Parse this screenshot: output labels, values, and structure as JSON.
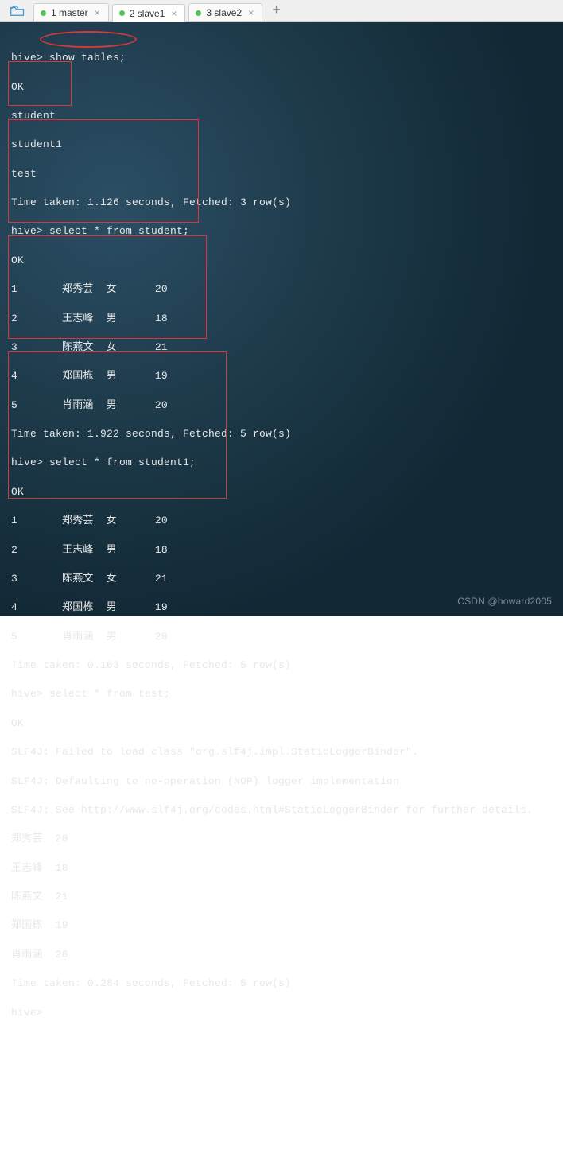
{
  "tabs": {
    "t1": "1 master",
    "t2": "2 slave1",
    "t3": "3 slave2",
    "active": "t2"
  },
  "terminal": {
    "prompt": "hive>",
    "cmd1": "show tables;",
    "ok": "OK",
    "tables": {
      "r0": "student",
      "r1": "student1",
      "r2": "test"
    },
    "time1": "Time taken: 1.126 seconds, Fetched: 3 row(s)",
    "cmd2": "select * from student;",
    "student": {
      "r0": "1       郑秀芸  女      20",
      "r1": "2       王志峰  男      18",
      "r2": "3       陈燕文  女      21",
      "r3": "4       郑国栋  男      19",
      "r4": "5       肖雨涵  男      20"
    },
    "time2": "Time taken: 1.922 seconds, Fetched: 5 row(s)",
    "cmd3": "select * from student1;",
    "student1": {
      "r0": "1       郑秀芸  女      20",
      "r1": "2       王志峰  男      18",
      "r2": "3       陈燕文  女      21",
      "r3": "4       郑国栋  男      19",
      "r4": "5       肖雨涵  男      20"
    },
    "time3": "Time taken: 0.163 seconds, Fetched: 5 row(s)",
    "cmd4": "select * from test;",
    "slf4j": {
      "l0": "SLF4J: Failed to load class \"org.slf4j.impl.StaticLoggerBinder\".",
      "l1": "SLF4J: Defaulting to no-operation (NOP) logger implementation",
      "l2": "SLF4J: See http://www.slf4j.org/codes.html#StaticLoggerBinder for further details."
    },
    "test": {
      "r0": "郑秀芸  20",
      "r1": "王志峰  18",
      "r2": "陈燕文  21",
      "r3": "郑国栋  19",
      "r4": "肖雨涵  20"
    },
    "time4": "Time taken: 0.284 seconds, Fetched: 5 row(s)"
  },
  "watermark": "CSDN @howard2005"
}
